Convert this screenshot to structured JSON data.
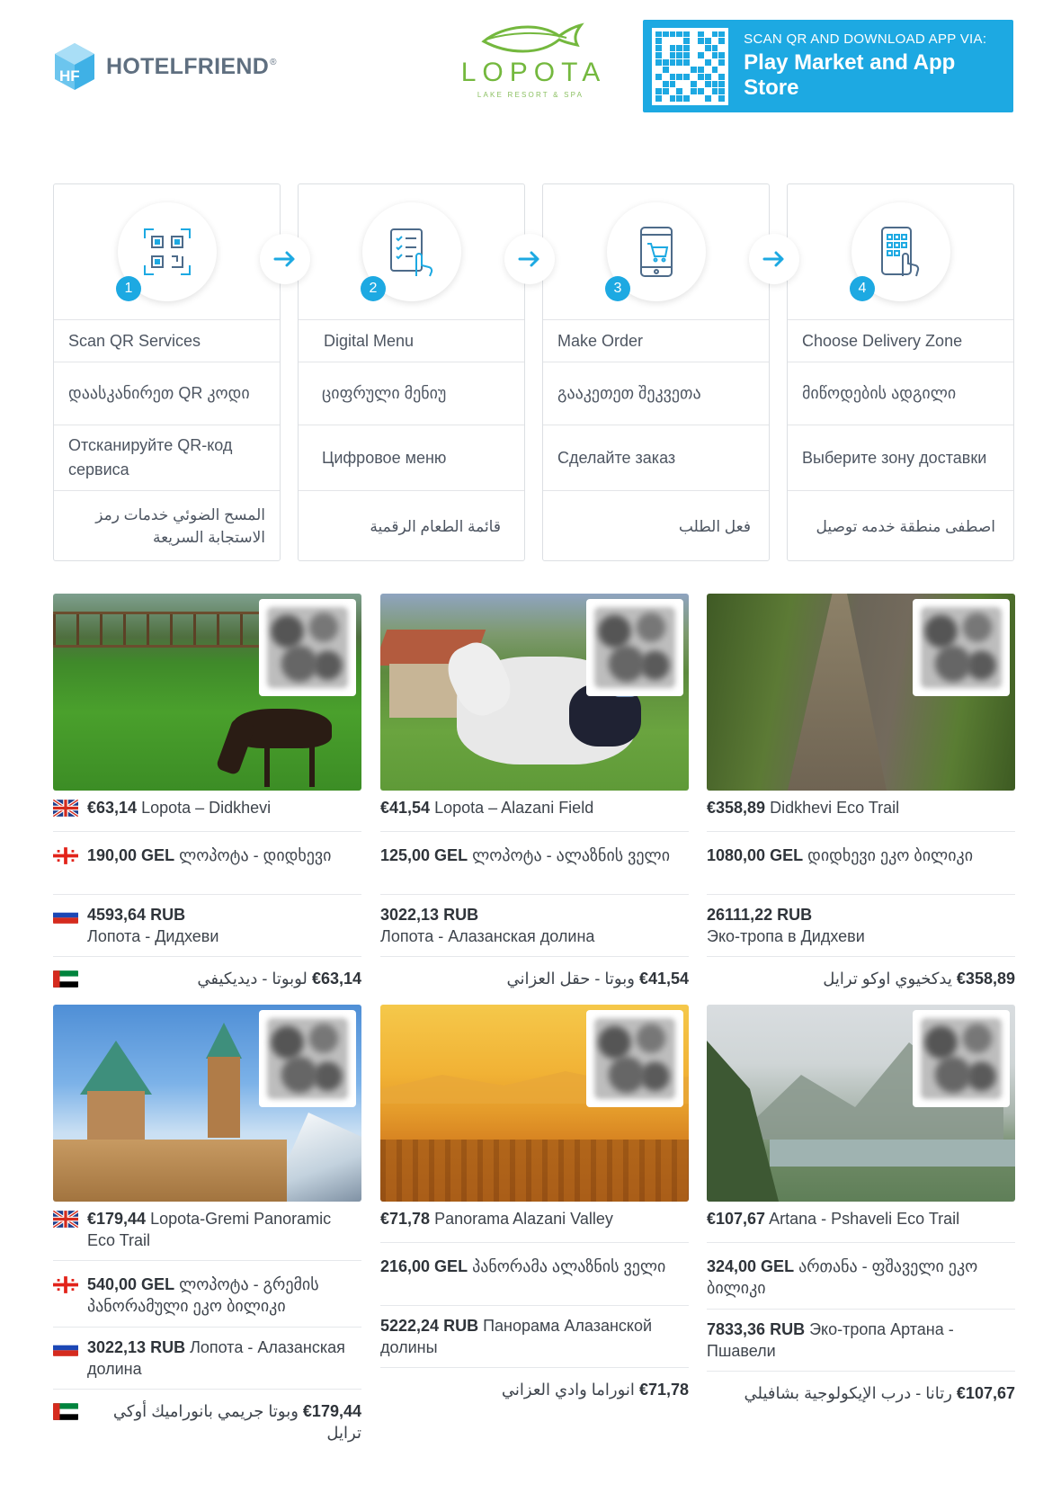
{
  "header": {
    "brand_name": "HOTELFRIEND",
    "brand_reg": "®",
    "brand_logo_icon": "hf-cube-icon",
    "resort_name": "LOPOTA",
    "resort_subtitle": "LAKE RESORT & SPA",
    "resort_logo_icon": "fish-icon",
    "qr_banner": {
      "line1": "SCAN QR AND DOWNLOAD APP VIA:",
      "line2": "Play Market and App Store"
    }
  },
  "colors": {
    "accent": "#1da9e2",
    "resort_green": "#74b83e",
    "text": "#3a3f47"
  },
  "steps": [
    {
      "num": "1",
      "icon": "qr-scan-icon",
      "en": "Scan QR Services",
      "ka": "დაასკანირეთ QR კოდი",
      "ru": "Отсканируйте QR-код сервиса",
      "ar": "المسح الضوئي خدمات رمز الاستجابة السريعة"
    },
    {
      "num": "2",
      "icon": "digital-menu-icon",
      "en": "Digital Menu",
      "ka": "ციფრული მენიუ",
      "ru": "Цифровое меню",
      "ar": "قائمة الطعام الرقمية"
    },
    {
      "num": "3",
      "icon": "phone-cart-icon",
      "en": "Make Order",
      "ka": "გააკეთეთ შეკვეთა",
      "ru": "Сделайте заказ",
      "ar": "فعل الطلب"
    },
    {
      "num": "4",
      "icon": "phone-tap-icon",
      "en": "Choose Delivery Zone",
      "ka": "მიწოდების ადგილი",
      "ru": "Выберите зону доставки",
      "ar": "اصطفى منطقة خدمه توصيل"
    }
  ],
  "arrow_icon": "arrow-right-icon",
  "cards": [
    {
      "image": "grazing-horse-photo",
      "en_price": "€63,14",
      "en_name": "Lopota – Didkhevi",
      "ka_price": "190,00 GEL",
      "ka_name": "ლოპოტა - დიდხევი",
      "ru_price": "4593,64 RUB",
      "ru_name": "Лопота - Дидхеви",
      "ar_price": "€63,14",
      "ar_name": "لوبوتا - ديديكيفي",
      "flags": true
    },
    {
      "image": "white-horse-rider-photo",
      "en_price": "€41,54",
      "en_name": "Lopota – Alazani Field",
      "ka_price": "125,00 GEL",
      "ka_name": "ლოპოტა - ალაზნის ველი",
      "ru_price": "3022,13 RUB",
      "ru_name": "Лопота - Алазанская долина",
      "ar_price": "€41,54",
      "ar_name": "وبوتا - حقل العزاني",
      "flags": false
    },
    {
      "image": "forest-trail-photo",
      "en_price": "€358,89",
      "en_name": "Didkhevi Eco Trail",
      "ka_price": "1080,00 GEL",
      "ka_name": "დიდხევი ეკო ბილიკი",
      "ru_price": "26111,22 RUB",
      "ru_name": "Эко-тропа в Дидхеви",
      "ar_price": "€358,89",
      "ar_name": "يدكخيوي اوكو ترايل",
      "flags": false
    },
    {
      "image": "gremi-church-photo",
      "en_price": "€179,44",
      "en_name": "Lopota-Gremi Panoramic Eco Trail",
      "ka_price": "540,00 GEL",
      "ka_name": "ლოპოტა - გრემის პანორამული ეკო ბილიკი",
      "ru_price": "3022,13 RUB",
      "ru_name": "Лопота - Алазанская долина",
      "ar_price": "€179,44",
      "ar_name": "وبوتا جريمي بانوراميك أوكي ترايل",
      "flags": true
    },
    {
      "image": "alazani-valley-sunset-photo",
      "en_price": "€71,78",
      "en_name": "Panorama Alazani Valley",
      "ka_price": "216,00 GEL",
      "ka_name": "პანორამა ალაზნის ველი",
      "ru_price": "5222,24 RUB",
      "ru_name": "Панорама Алазанской долины",
      "ar_price": "€71,78",
      "ar_name": "انوراما وادي العزاني",
      "flags": false
    },
    {
      "image": "artana-mountains-photo",
      "en_price": "€107,67",
      "en_name": "Artana - Pshaveli Eco Trail",
      "ka_price": "324,00 GEL",
      "ka_name": "ართანა - ფშაველი ეკო ბილიკი",
      "ru_price": "7833,36 RUB",
      "ru_name": "Эко-тропа Артана - Пшавели",
      "ar_price": "€107,67",
      "ar_name": "رتانا - درب الإيكولوجية بشافيلي",
      "flags": false
    }
  ]
}
